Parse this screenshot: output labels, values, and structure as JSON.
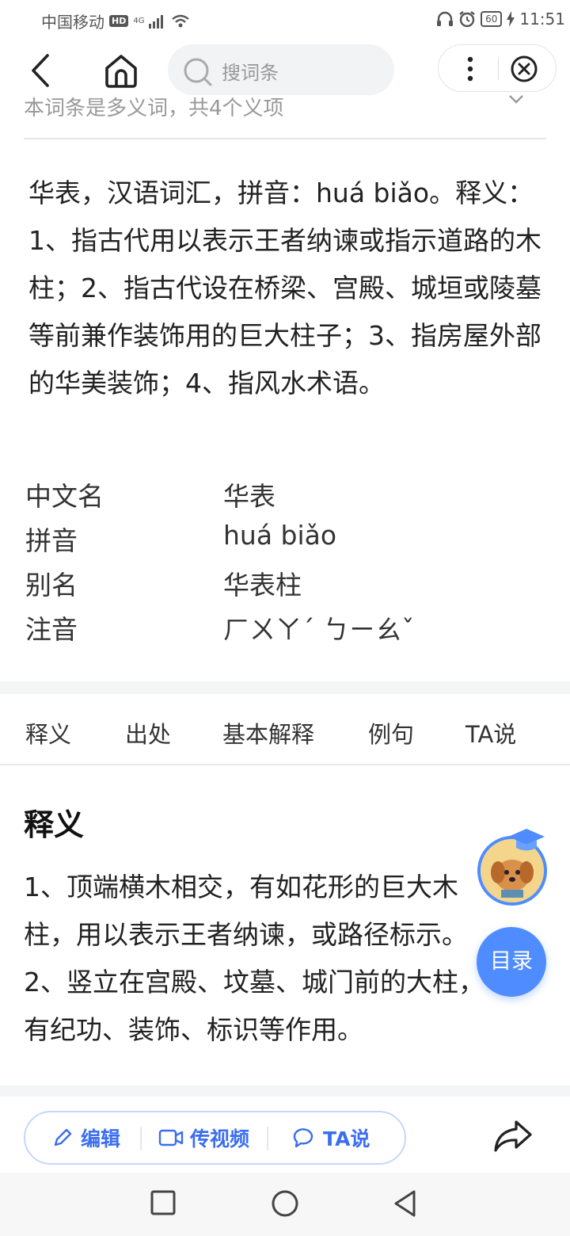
{
  "status": {
    "carrier": "中国移动",
    "hd": "HD",
    "network": "4G",
    "battery": "60",
    "time": "11:51"
  },
  "nav": {
    "search_placeholder": "搜词条"
  },
  "polysemy_text": "本词条是多义词，共4个义项",
  "summary": "华表，汉语词汇，拼音：huá biǎo。释义：1、指古代用以表示王者纳谏或指示道路的木柱；2、指古代设在桥梁、宫殿、城垣或陵墓等前兼作装饰用的巨大柱子；3、指房屋外部的华美装饰；4、指风水术语。",
  "info_table": [
    {
      "key": "中文名",
      "value": "华表"
    },
    {
      "key": "拼音",
      "value": "huá biǎo"
    },
    {
      "key": "别名",
      "value": "华表柱"
    },
    {
      "key": "注音",
      "value": "ㄏㄨㄚˊ ㄅㄧㄠˇ"
    }
  ],
  "tabs": [
    "释义",
    "出处",
    "基本解释",
    "例句",
    "TA说"
  ],
  "section": {
    "title": "释义",
    "lines": [
      "1、顶端横木相交，有如花形的巨大木",
      "柱，用以表示王者纳谏，或路径标示。",
      "2、竖立在宫殿、坟墓、城门前的大柱，",
      "有纪功、装饰、标识等作用。"
    ]
  },
  "toc_label": "目录",
  "actions": {
    "edit": "编辑",
    "video": "传视频",
    "ta": "TA说"
  },
  "colors": {
    "accent": "#4f8cff",
    "action_text": "#3a6df0"
  }
}
